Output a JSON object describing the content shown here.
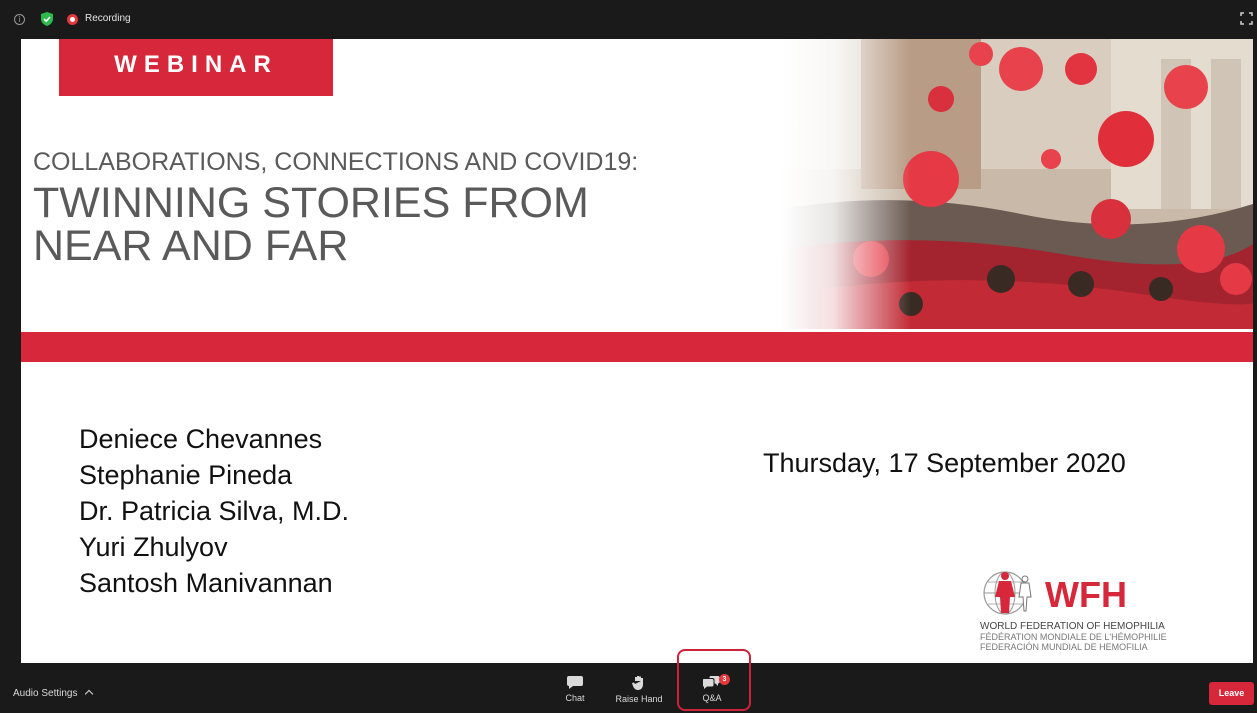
{
  "topbar": {
    "recording_label": "Recording",
    "icons": {
      "info": "info-icon",
      "shield": "shield-check-icon",
      "record": "record-icon",
      "fullscreen": "fullscreen-icon"
    },
    "info_glyph": "i"
  },
  "slide": {
    "webinar_label": "WEBINAR",
    "subtitle": "COLLABORATIONS, CONNECTIONS AND COVID19:",
    "title_lines": [
      "TWINNING STORIES FROM",
      "NEAR AND FAR"
    ],
    "speakers": [
      "Deniece Chevannes",
      "Stephanie Pineda",
      "Dr. Patricia Silva, M.D.",
      "Yuri Zhulyov",
      "Santosh Manivannan"
    ],
    "date": "Thursday, 17 September 2020",
    "org": {
      "short": "WFH",
      "lines": [
        "WORLD FEDERATION OF HEMOPHILIA",
        "FÉDÉRATION MONDIALE DE L'HÉMOPHILIE",
        "FEDERACIÓN MUNDIAL DE HEMOFILIA"
      ]
    }
  },
  "bottombar": {
    "audio_settings_label": "Audio Settings",
    "chat_label": "Chat",
    "raise_hand_label": "Raise Hand",
    "qa_label": "Q&A",
    "qa_badge": "3",
    "leave_label": "Leave"
  },
  "colors": {
    "brand_red": "#d6283a",
    "toolbar_bg": "#1a1a1a",
    "highlight": "#d0203a"
  }
}
